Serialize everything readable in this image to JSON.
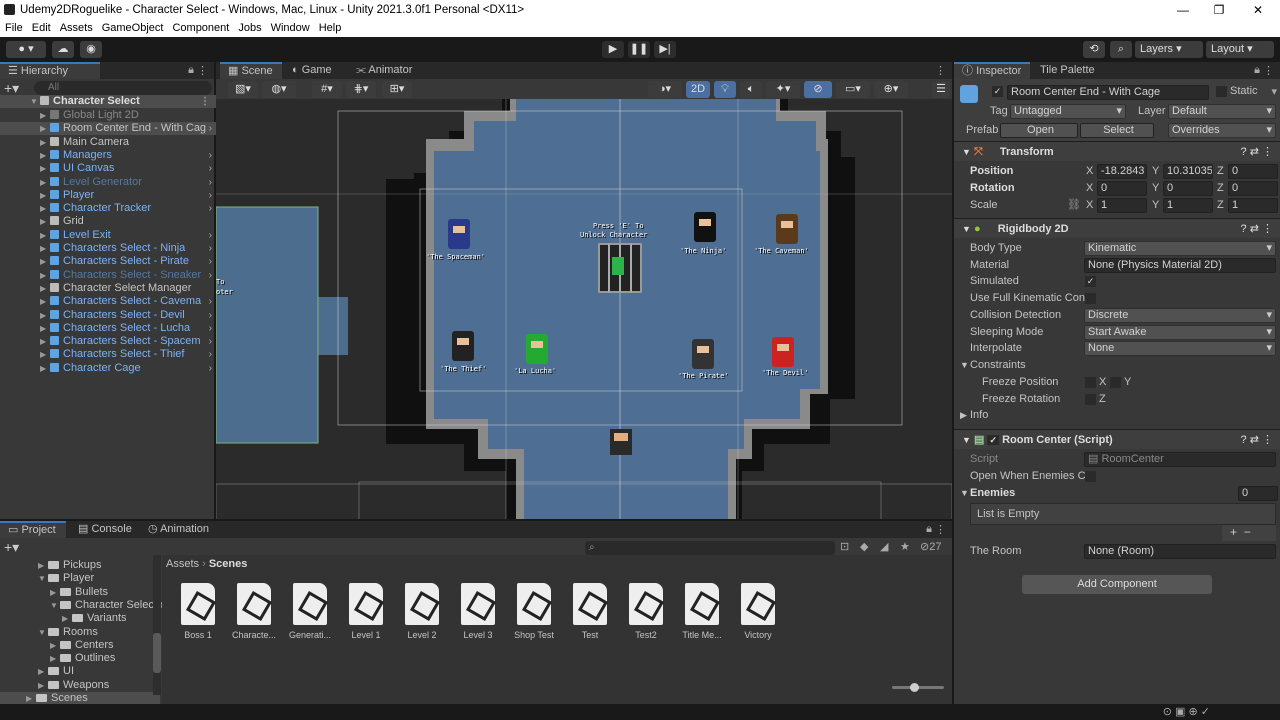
{
  "window": {
    "title": "Udemy2DRoguelike - Character Select - Windows, Mac, Linux - Unity 2021.3.0f1 Personal <DX11>",
    "minimize": "—",
    "maximize": "❐",
    "close": "✕"
  },
  "menu": [
    "File",
    "Edit",
    "Assets",
    "GameObject",
    "Component",
    "Jobs",
    "Window",
    "Help"
  ],
  "toolbar": {
    "layers": "Layers",
    "layout": "Layout"
  },
  "hierarchy": {
    "tab": "Hierarchy",
    "search_placeholder": "All",
    "root": "Character Select",
    "items": [
      {
        "label": "Global Light 2D",
        "style": "dim"
      },
      {
        "label": "Room Center End - With Cag",
        "style": "selected"
      },
      {
        "label": "Main Camera",
        "style": "normal"
      },
      {
        "label": "Managers",
        "style": "blue"
      },
      {
        "label": "UI Canvas",
        "style": "blue"
      },
      {
        "label": "Level Generator",
        "style": "dimblue"
      },
      {
        "label": "Player",
        "style": "blue"
      },
      {
        "label": "Character Tracker",
        "style": "blue"
      },
      {
        "label": "Grid",
        "style": "normal"
      },
      {
        "label": "Level Exit",
        "style": "blue"
      },
      {
        "label": "Characters Select - Ninja",
        "style": "blue"
      },
      {
        "label": "Characters Select - Pirate",
        "style": "blue"
      },
      {
        "label": "Characters Select - Sneaker",
        "style": "dimblue"
      },
      {
        "label": "Character Select Manager",
        "style": "normal"
      },
      {
        "label": "Characters Select - Cavema",
        "style": "blue"
      },
      {
        "label": "Characters Select - Devil",
        "style": "blue"
      },
      {
        "label": "Characters Select - Lucha",
        "style": "blue"
      },
      {
        "label": "Characters Select - Spacem",
        "style": "blue"
      },
      {
        "label": "Characters Select - Thief",
        "style": "blue"
      },
      {
        "label": "Character Cage",
        "style": "blue"
      }
    ]
  },
  "scene_tabs": [
    "Scene",
    "Game",
    "Animator"
  ],
  "scene_toolbar": {
    "mode_2d": "2D"
  },
  "scene": {
    "prompt_line1": "Press 'E' To",
    "prompt_line2": "Unlock Character",
    "left_text_1": "To",
    "left_text_2": "oter",
    "characters": [
      {
        "name": "'The Spaceman'",
        "color": "#2a3a8a"
      },
      {
        "name": "'The Ninja'",
        "color": "#111111"
      },
      {
        "name": "'The Caveman'",
        "color": "#5a3a1a"
      },
      {
        "name": "'The Thief'",
        "color": "#222222"
      },
      {
        "name": "'La Lucha'",
        "color": "#22aa33"
      },
      {
        "name": "'The Pirate'",
        "color": "#333333"
      },
      {
        "name": "'The Devil'",
        "color": "#cc2222"
      }
    ]
  },
  "inspector": {
    "tabs": [
      "Inspector",
      "Tile Palette"
    ],
    "object_name": "Room Center End - With Cage",
    "static_label": "Static",
    "tag_label": "Tag",
    "tag_value": "Untagged",
    "layer_label": "Layer",
    "layer_value": "Default",
    "prefab_label": "Prefab",
    "prefab_open": "Open",
    "prefab_select": "Select",
    "prefab_overrides": "Overrides",
    "transform": {
      "title": "Transform",
      "position_label": "Position",
      "px": "-18.2843",
      "py": "10.31035",
      "pz": "0",
      "rotation_label": "Rotation",
      "rx": "0",
      "ry": "0",
      "rz": "0",
      "scale_label": "Scale",
      "sx": "1",
      "sy": "1",
      "sz": "1"
    },
    "rigidbody": {
      "title": "Rigidbody 2D",
      "rows": [
        {
          "label": "Body Type",
          "value": "Kinematic",
          "kind": "dropdown"
        },
        {
          "label": "Material",
          "value": "None (Physics Material 2D)",
          "kind": "object"
        },
        {
          "label": "Simulated",
          "value": "✓",
          "kind": "checkbox"
        },
        {
          "label": "Use Full Kinematic Cont",
          "value": "",
          "kind": "checkbox"
        },
        {
          "label": "Collision Detection",
          "value": "Discrete",
          "kind": "dropdown"
        },
        {
          "label": "Sleeping Mode",
          "value": "Start Awake",
          "kind": "dropdown"
        },
        {
          "label": "Interpolate",
          "value": "None",
          "kind": "dropdown"
        }
      ],
      "constraints": "Constraints",
      "freeze_position": "Freeze Position",
      "freeze_rotation": "Freeze Rotation",
      "x": "X",
      "y": "Y",
      "z": "Z",
      "info": "Info"
    },
    "room_center": {
      "title": "Room Center (Script)",
      "script_label": "Script",
      "script_value": "RoomCenter",
      "open_label": "Open When Enemies Cle",
      "enemies_label": "Enemies",
      "enemies_count": "0",
      "list_empty": "List is Empty",
      "room_label": "The Room",
      "room_value": "None (Room)"
    },
    "add_component": "Add Component"
  },
  "project": {
    "tabs": [
      "Project",
      "Console",
      "Animation"
    ],
    "tree": [
      {
        "label": "Pickups",
        "indent": 1
      },
      {
        "label": "Player",
        "indent": 1,
        "open": true
      },
      {
        "label": "Bullets",
        "indent": 2
      },
      {
        "label": "Character Selecto",
        "indent": 2,
        "open": true
      },
      {
        "label": "Variants",
        "indent": 3
      },
      {
        "label": "Rooms",
        "indent": 1,
        "open": true
      },
      {
        "label": "Centers",
        "indent": 2
      },
      {
        "label": "Outlines",
        "indent": 2
      },
      {
        "label": "UI",
        "indent": 1
      },
      {
        "label": "Weapons",
        "indent": 1
      },
      {
        "label": "Scenes",
        "indent": 0,
        "selected": true
      }
    ],
    "breadcrumb_root": "Assets",
    "breadcrumb_current": "Scenes",
    "hidden_count": "27",
    "assets": [
      "Boss 1",
      "Characte...",
      "Generati...",
      "Level 1",
      "Level 2",
      "Level 3",
      "Shop Test",
      "Test",
      "Test2",
      "Title Me...",
      "Victory"
    ]
  }
}
